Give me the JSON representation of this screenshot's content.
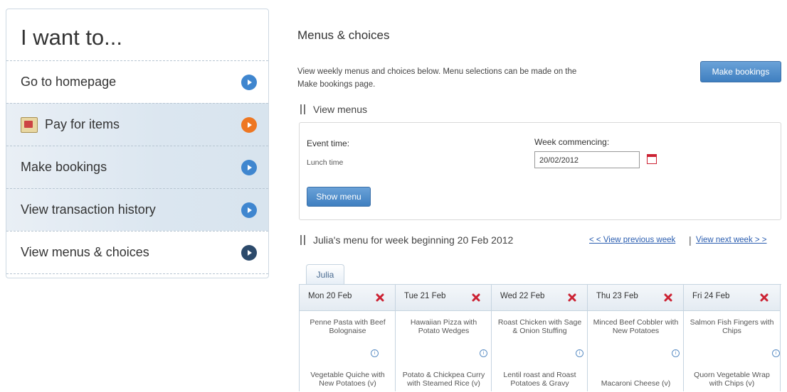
{
  "sidebar": {
    "title": "I want to...",
    "items": [
      {
        "label": "Go to homepage"
      },
      {
        "label": "Pay for items"
      },
      {
        "label": "Make bookings"
      },
      {
        "label": "View transaction history"
      },
      {
        "label": "View menus & choices"
      }
    ]
  },
  "main": {
    "title": "Menus & choices",
    "intro": "View weekly menus and choices below. Menu selections can be made on the Make bookings page.",
    "make_bookings_button": "Make bookings",
    "view_menus_heading": "View menus",
    "event_time_label": "Event time:",
    "event_time_value": "Lunch time",
    "week_commencing_label": "Week commencing:",
    "week_commencing_value": "20/02/2012",
    "show_menu_button": "Show menu",
    "week_heading": "Julia's menu for week beginning 20 Feb 2012",
    "prev_week_link": "< < View previous week",
    "separator": "|",
    "next_week_link": "View next week > >",
    "tab_label": "Julia",
    "info_glyph": "i",
    "days": [
      {
        "label": "Mon 20 Feb",
        "meal1": "Penne Pasta with Beef Bolognaise",
        "meal2": "Vegetable Quiche with New Potatoes (v)"
      },
      {
        "label": "Tue 21 Feb",
        "meal1": "Hawaiian Pizza with Potato Wedges",
        "meal2": "Potato & Chickpea Curry with Steamed Rice (v)"
      },
      {
        "label": "Wed 22 Feb",
        "meal1": "Roast Chicken with Sage & Onion Stuffing",
        "meal2": "Lentil roast and Roast Potatoes & Gravy"
      },
      {
        "label": "Thu 23 Feb",
        "meal1": "Minced Beef Cobbler with New Potatoes",
        "meal2": "Macaroni Cheese (v)"
      },
      {
        "label": "Fri 24 Feb",
        "meal1": "Salmon Fish Fingers with Chips",
        "meal2": "Quorn Vegetable Wrap with Chips (v)"
      }
    ]
  },
  "colors": {
    "accent_blue": "#3f86cf",
    "pay_orange": "#ee7722",
    "current_dark": "#2c4a6b",
    "close_red": "#cc2233",
    "link_blue": "#2a5db0"
  }
}
